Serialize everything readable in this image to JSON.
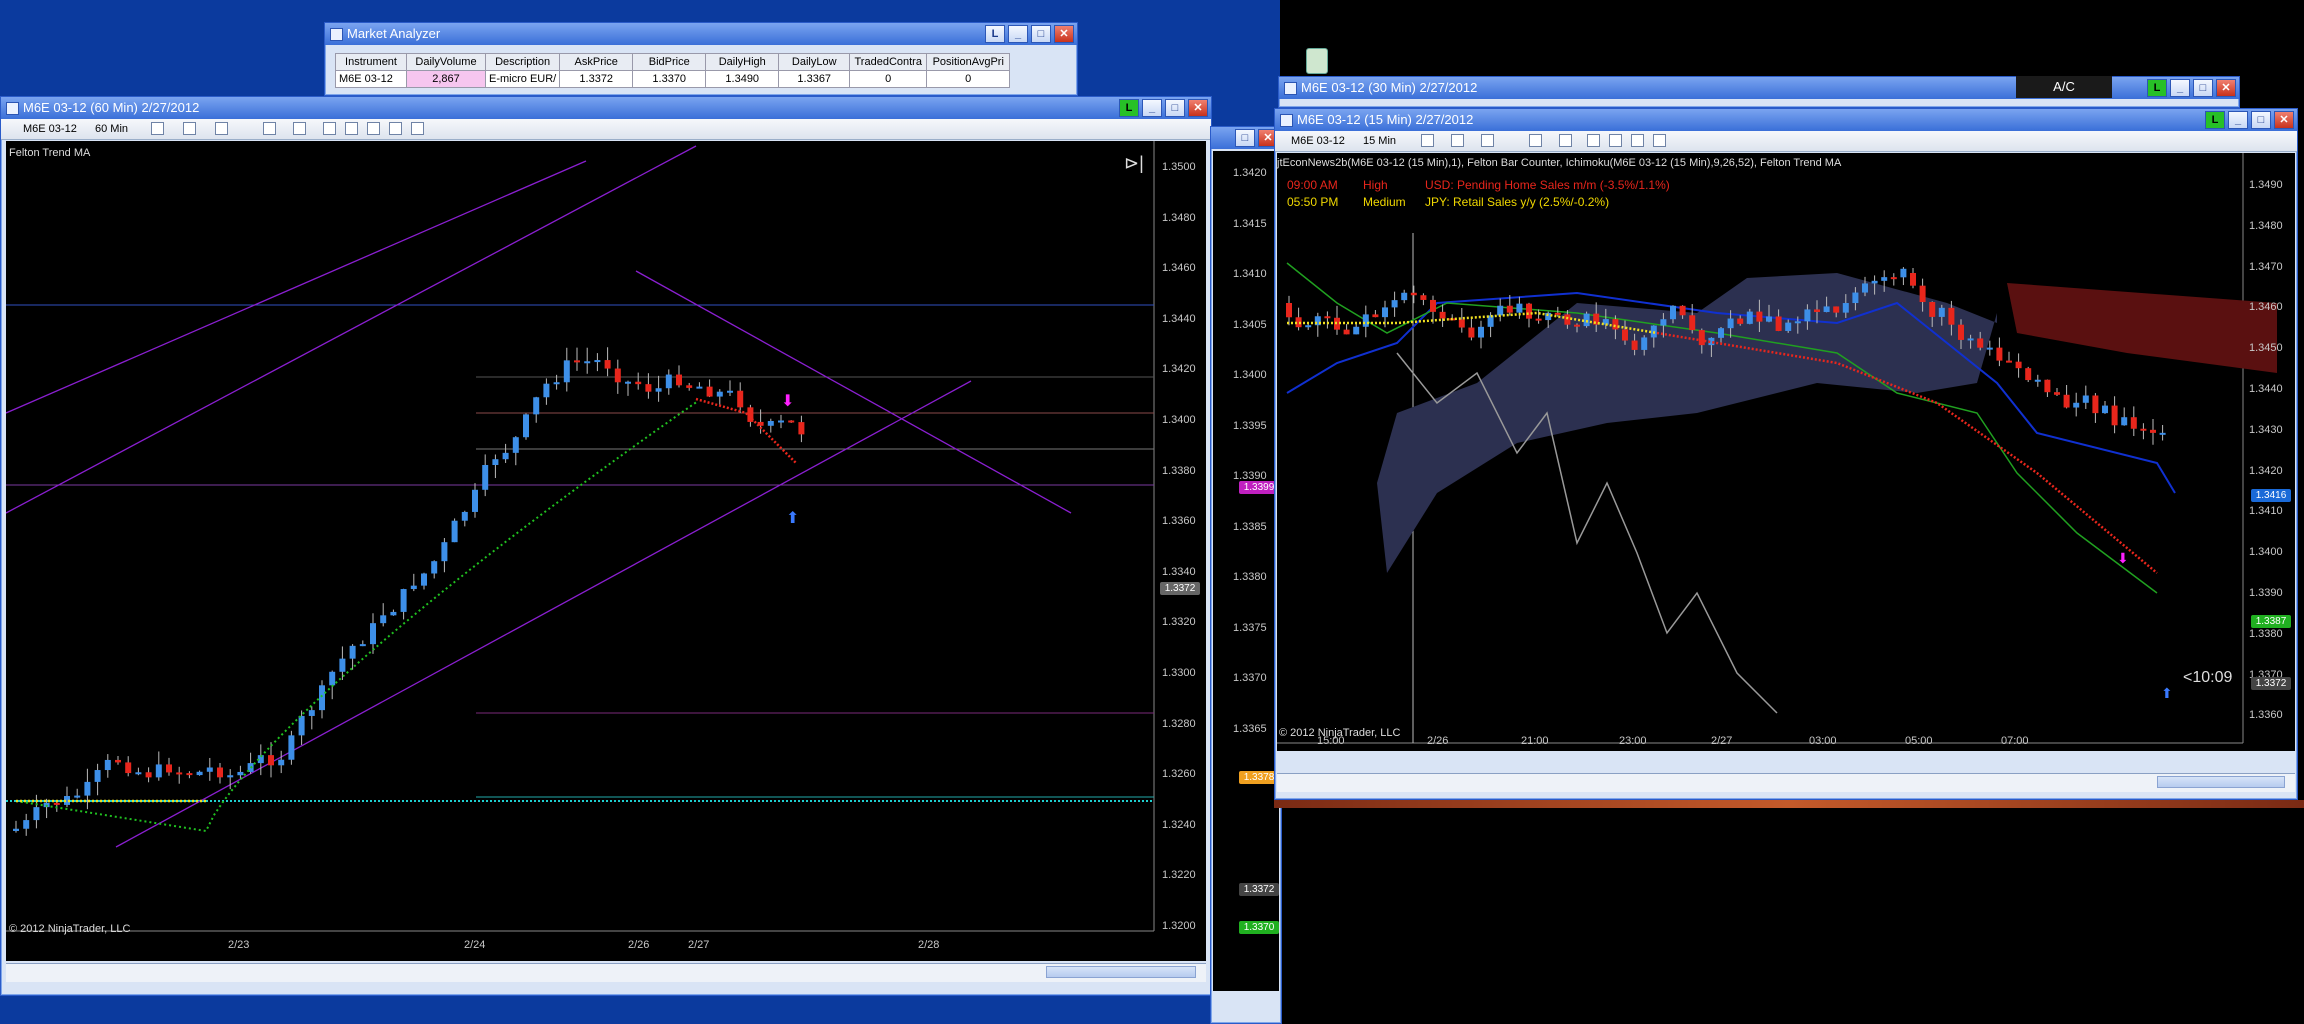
{
  "market_analyzer": {
    "title": "Market Analyzer",
    "columns": [
      "Instrument",
      "DailyVolume",
      "Description",
      "AskPrice",
      "BidPrice",
      "DailyHigh",
      "DailyLow",
      "TradedContra",
      "PositionAvgPri"
    ],
    "row": [
      "M6E 03-12",
      "2,867",
      "E-micro EUR/",
      "1.3372",
      "1.3370",
      "1.3490",
      "1.3367",
      "0",
      "0"
    ]
  },
  "chart60": {
    "title": "M6E 03-12 (60 Min)  2/27/2012",
    "instrument": "M6E 03-12",
    "interval": "60 Min",
    "indicator": "Felton Trend MA",
    "copyright": "© 2012 NinjaTrader, LLC",
    "y_ticks": [
      "1.3500",
      "1.3480",
      "1.3460",
      "1.3440",
      "1.3420",
      "1.3400",
      "1.3380",
      "1.3360",
      "1.3340",
      "1.3320",
      "1.3300",
      "1.3280",
      "1.3260",
      "1.3240",
      "1.3220",
      "1.3200"
    ],
    "x_ticks": [
      "2/23",
      "2/24",
      "2/26",
      "2/27",
      "2/28"
    ],
    "price_tag": "1.3372"
  },
  "chart_hidden": {
    "y_ticks": [
      "1.3420",
      "1.3415",
      "1.3410",
      "1.3405",
      "1.3400",
      "1.3395",
      "1.3390",
      "1.3385",
      "1.3380",
      "1.3375",
      "1.3370",
      "1.3365"
    ],
    "tags": [
      "1.3399",
      "1.3378",
      "1.3372",
      "1.3370"
    ]
  },
  "chart30": {
    "title": "M6E 03-12 (30 Min)  2/27/2012",
    "ac": "A/C"
  },
  "chart15": {
    "title": "M6E 03-12 (15 Min)  2/27/2012",
    "instrument": "M6E 03-12",
    "interval": "15 Min",
    "indicator_line": "jtEconNews2b(M6E 03-12 (15 Min),1), Felton Bar Counter,  Ichimoku(M6E 03-12 (15 Min),9,26,52), Felton Trend MA",
    "news": [
      {
        "time": "09:00 AM",
        "impact": "High",
        "text": "USD: Pending Home Sales m/m (-3.5%/1.1%)"
      },
      {
        "time": "05:50 PM",
        "impact": "Medium",
        "text": "JPY: Retail Sales y/y (2.5%/-0.2%)"
      }
    ],
    "copyright": "© 2012 NinjaTrader, LLC",
    "y_ticks": [
      "1.3490",
      "1.3480",
      "1.3470",
      "1.3460",
      "1.3450",
      "1.3440",
      "1.3430",
      "1.3420",
      "1.3410",
      "1.3400",
      "1.3390",
      "1.3380",
      "1.3370",
      "1.3360"
    ],
    "x_ticks": [
      "15:00",
      "2/26",
      "21:00",
      "23:00",
      "2/27",
      "03:00",
      "05:00",
      "07:00"
    ],
    "tags": [
      "1.3416",
      "1.3387",
      "1.3372"
    ],
    "countdown": "<10:09"
  },
  "colors": {
    "up": "#3d8fe8",
    "down": "#e8261c",
    "trend": "#8a1fd0"
  }
}
